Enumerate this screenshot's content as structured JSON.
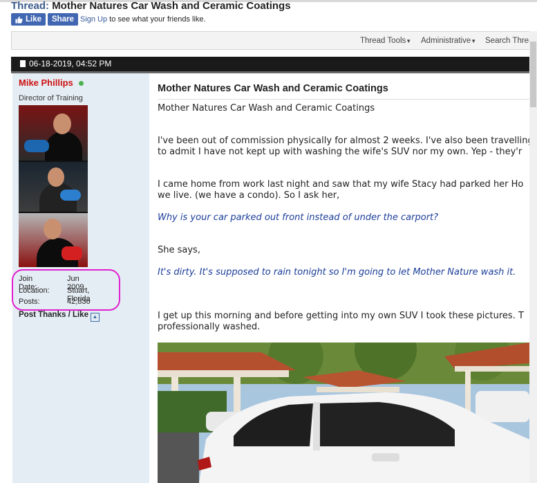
{
  "thread": {
    "label": "Thread:",
    "title": "Mother Natures Car Wash and Ceramic Coatings"
  },
  "facebook": {
    "like": "Like",
    "share": "Share",
    "signup": "Sign Up",
    "text": " to see what your friends like."
  },
  "tools": {
    "thread_tools": "Thread Tools",
    "administrative": "Administrative",
    "search": "Search Thread"
  },
  "post": {
    "date": "06-18-2019, 04:52 PM",
    "title": "Mother Natures Car Wash and Ceramic Coatings",
    "lines": [
      "Mother Natures Car Wash and Ceramic Coatings",
      "I've been out of commission physically for almost 2 weeks. I've also been travelling",
      "to admit I have not kept up with washing the wife's SUV nor my own. Yep - they'r",
      "I came home from work last night and saw that my wife Stacy had parked her Ho",
      "we live. (we have a condo). So I ask her,",
      "Why is your car parked out front instead of under the carport?",
      "She says,",
      "It's dirty. It's supposed to rain tonight so I'm going to let Mother Nature wash it.",
      "I get up this morning and before getting into my own SUV I took these pictures. T",
      "professionally washed."
    ]
  },
  "user": {
    "name": "Mike Phillips",
    "title": "Director of Training",
    "join_label": "Join Date:",
    "join": "Jun 2009",
    "location_label": "Location:",
    "location": "Stuart, Florida",
    "posts_label": "Posts:",
    "posts": "42,836",
    "thanks": "Post Thanks / Like"
  }
}
